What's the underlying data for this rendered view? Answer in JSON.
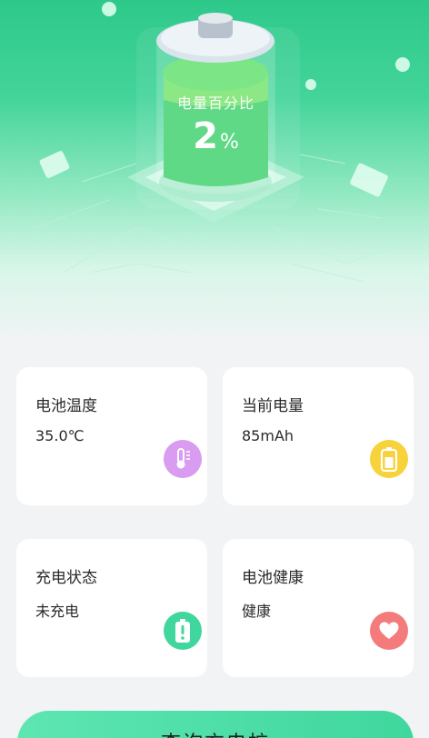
{
  "battery": {
    "label": "电量百分比",
    "percent": "2",
    "unit": "%"
  },
  "cards": [
    {
      "title": "电池温度",
      "value": "35.0℃",
      "icon": "thermometer-icon",
      "color": "#d99cf0"
    },
    {
      "title": "当前电量",
      "value": "85mAh",
      "icon": "battery-icon",
      "color": "#f7d23a"
    },
    {
      "title": "充电状态",
      "value": "未充电",
      "icon": "battery-alert-icon",
      "color": "#3fd79d"
    },
    {
      "title": "电池健康",
      "value": "健康",
      "icon": "heart-icon",
      "color": "#f47b7b"
    }
  ],
  "query_button": {
    "label": "查询充电桩"
  },
  "theme": {
    "accent": "#3fd79d",
    "background": "#f2f3f5"
  }
}
